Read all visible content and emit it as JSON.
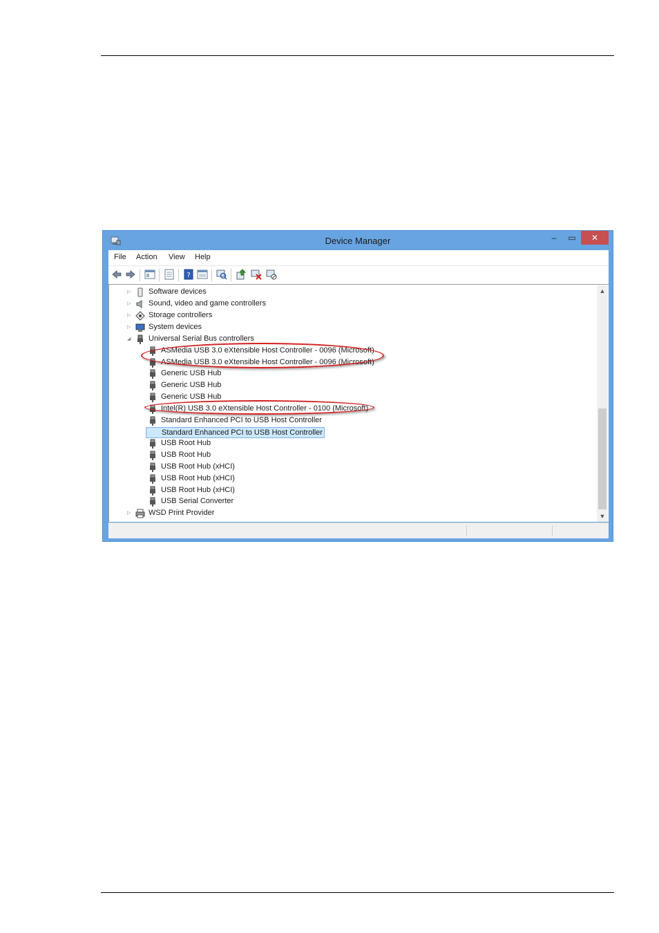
{
  "window": {
    "title": "Device Manager",
    "caption_buttons": {
      "minimize": "–",
      "maximize": "▭",
      "close": "✕"
    }
  },
  "menu": [
    "File",
    "Action",
    "View",
    "Help"
  ],
  "toolbar": {
    "icons": [
      "back-icon",
      "forward-icon",
      "properties-view-icon",
      "list-icon",
      "help-icon",
      "device-view-icon",
      "scan-hardware-icon",
      "update-driver-icon",
      "uninstall-device-icon",
      "disable-device-icon"
    ]
  },
  "tree": {
    "categories": [
      {
        "label": "Software devices",
        "expanded": false
      },
      {
        "label": "Sound, video and game controllers",
        "expanded": false
      },
      {
        "label": "Storage controllers",
        "expanded": false
      },
      {
        "label": "System devices",
        "expanded": false
      },
      {
        "label": "Universal Serial Bus controllers",
        "expanded": true
      },
      {
        "label": "WSD Print Provider",
        "expanded": false
      }
    ],
    "usb_devices": [
      "ASMedia USB 3.0 eXtensible Host Controller - 0096 (Microsoft)",
      "ASMedia USB 3.0 eXtensible Host Controller - 0096 (Microsoft)",
      "Generic USB Hub",
      "Generic USB Hub",
      "Generic USB Hub",
      "Intel(R) USB 3.0 eXtensible Host Controller - 0100 (Microsoft)",
      "Standard Enhanced PCI to USB Host Controller",
      "Standard Enhanced PCI to USB Host Controller",
      "USB Root Hub",
      "USB Root Hub",
      "USB Root Hub (xHCI)",
      "USB Root Hub (xHCI)",
      "USB Root Hub (xHCI)",
      "USB Serial Converter"
    ],
    "selected_device": "Standard Enhanced PCI to USB Host Controller",
    "expander_collapsed": "▷",
    "expander_expanded": "◢"
  },
  "scroll_arrows": {
    "up": "▲",
    "down": "▼"
  },
  "colors": {
    "highlight_ring": "#d42020",
    "selection": "#cce8ff",
    "title_bar": "#68a4e1",
    "close_button": "#c74f50"
  }
}
